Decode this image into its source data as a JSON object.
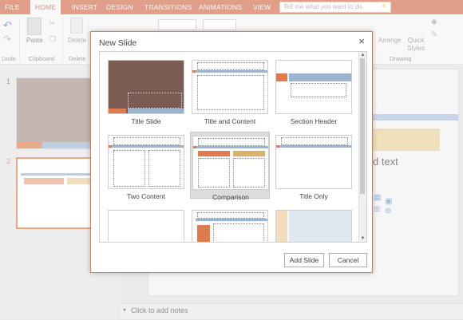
{
  "ribbon": {
    "tabs": [
      "FILE",
      "HOME",
      "INSERT",
      "DESIGN",
      "TRANSITIONS",
      "ANIMATIONS",
      "VIEW"
    ],
    "active_tab": "HOME",
    "tell_me_placeholder": "Tell me what you want to do",
    "groups": {
      "undo": "Undo",
      "clipboard": "Clipboard",
      "delete": "Delete",
      "drawing": "Drawing"
    },
    "buttons": {
      "paste": "Paste",
      "delete": "Delete",
      "arrange": "Arrange",
      "quick_styles": "Quick Styles"
    }
  },
  "slides_pane": {
    "slides": [
      {
        "number": "1"
      },
      {
        "number": "2"
      }
    ],
    "selected": "2"
  },
  "editor": {
    "placeholder_text": "d text",
    "notes_placeholder": "Click to add notes"
  },
  "dialog": {
    "title": "New Slide",
    "close_glyph": "×",
    "layouts": [
      "Title Slide",
      "Title and Content",
      "Section Header",
      "Two Content",
      "Comparison",
      "Title Only",
      "",
      "",
      ""
    ],
    "selected_layout": "Comparison",
    "add_button": "Add Slide",
    "cancel_button": "Cancel"
  },
  "colors": {
    "accent": "#d26a4a",
    "brown": "#7a5c52",
    "orange": "#e07a4a",
    "blue_bar": "#9bb5cf",
    "tan": "#d9b36a"
  }
}
